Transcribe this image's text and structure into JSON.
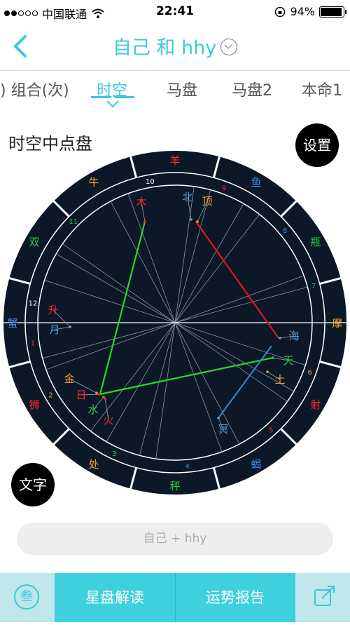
{
  "status_bar": {
    "carrier": "中国联通",
    "time": "22:41",
    "battery": "94%"
  },
  "nav": {
    "title": "自己 和 hhy"
  },
  "tabs": [
    "组合(次)",
    "时空",
    "马盘",
    "马盘2",
    "本命1"
  ],
  "active_tab": "时空",
  "section_title": "时空中点盘",
  "settings_label": "设置",
  "text_label": "文字",
  "input_placeholder": "自己 + hhy",
  "bottom_bar": {
    "read_label": "星盘解读",
    "report_label": "运势报告"
  },
  "chart": {
    "signs": [
      {
        "name": "羊",
        "color": "#ff2a2a"
      },
      {
        "name": "鱼",
        "color": "#3a8ee8"
      },
      {
        "name": "瓶",
        "color": "#22cc44"
      },
      {
        "name": "摩",
        "color": "#f3a52b"
      },
      {
        "name": "射",
        "color": "#ff2a2a"
      },
      {
        "name": "蝎",
        "color": "#3a8ee8"
      },
      {
        "name": "秤",
        "color": "#22cc44"
      },
      {
        "name": "处",
        "color": "#f3a52b"
      },
      {
        "name": "狮",
        "color": "#ff2a2a"
      },
      {
        "name": "蟹",
        "color": "#3a8ee8"
      },
      {
        "name": "双",
        "color": "#22cc44"
      },
      {
        "name": "牛",
        "color": "#f3a52b"
      }
    ],
    "houses": [
      {
        "n": "10",
        "color": "#ffffff"
      },
      {
        "n": "9",
        "color": "#ff2a2a"
      },
      {
        "n": "8",
        "color": "#3a8ee8"
      },
      {
        "n": "7",
        "color": "#22cc44"
      },
      {
        "n": "6",
        "color": "#f3a52b"
      },
      {
        "n": "5",
        "color": "#ff2a2a"
      },
      {
        "n": "4",
        "color": "#3a8ee8"
      },
      {
        "n": "3",
        "color": "#22cc44"
      },
      {
        "n": "2",
        "color": "#f3a52b"
      },
      {
        "n": "1",
        "color": "#ff2a2a"
      },
      {
        "n": "12",
        "color": "#ffffff"
      },
      {
        "n": "11",
        "color": "#22cc44"
      }
    ],
    "planets": [
      {
        "name": "木",
        "color": "#ff2a2a"
      },
      {
        "name": "北",
        "color": "#5aa0e0"
      },
      {
        "name": "顶",
        "color": "#f3a52b"
      },
      {
        "name": "升",
        "color": "#ff2a2a"
      },
      {
        "name": "月",
        "color": "#5aa0e0"
      },
      {
        "name": "海",
        "color": "#5aa0e0"
      },
      {
        "name": "天",
        "color": "#22cc44"
      },
      {
        "name": "土",
        "color": "#f3a52b"
      },
      {
        "name": "金",
        "color": "#f3a52b"
      },
      {
        "name": "日",
        "color": "#ff2a2a"
      },
      {
        "name": "水",
        "color": "#22cc44"
      },
      {
        "name": "火",
        "color": "#ff2a2a"
      },
      {
        "name": "冥",
        "color": "#5aa0e0"
      }
    ]
  }
}
